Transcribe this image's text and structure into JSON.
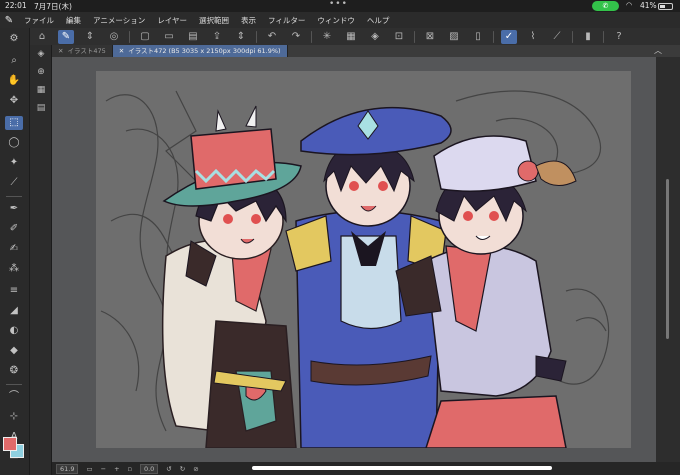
{
  "status": {
    "time": "22:01",
    "date": "7月7日(木)",
    "battery": "41%"
  },
  "menu": {
    "items": [
      "ファイル",
      "編集",
      "アニメーション",
      "レイヤー",
      "選択範囲",
      "表示",
      "フィルター",
      "ウィンドウ",
      "ヘルプ"
    ]
  },
  "tabs": [
    {
      "label": "イラスト475",
      "active": false
    },
    {
      "label": "イラスト472 (B5 3035 x 2150px 300dpi 61.9%)",
      "active": true
    }
  ],
  "bottom": {
    "zoom": "61.9",
    "rotation": "0.0"
  },
  "colors": {
    "main": "#e06a6a",
    "sub": "#8fd0e0",
    "accent": "#4a6da8"
  }
}
